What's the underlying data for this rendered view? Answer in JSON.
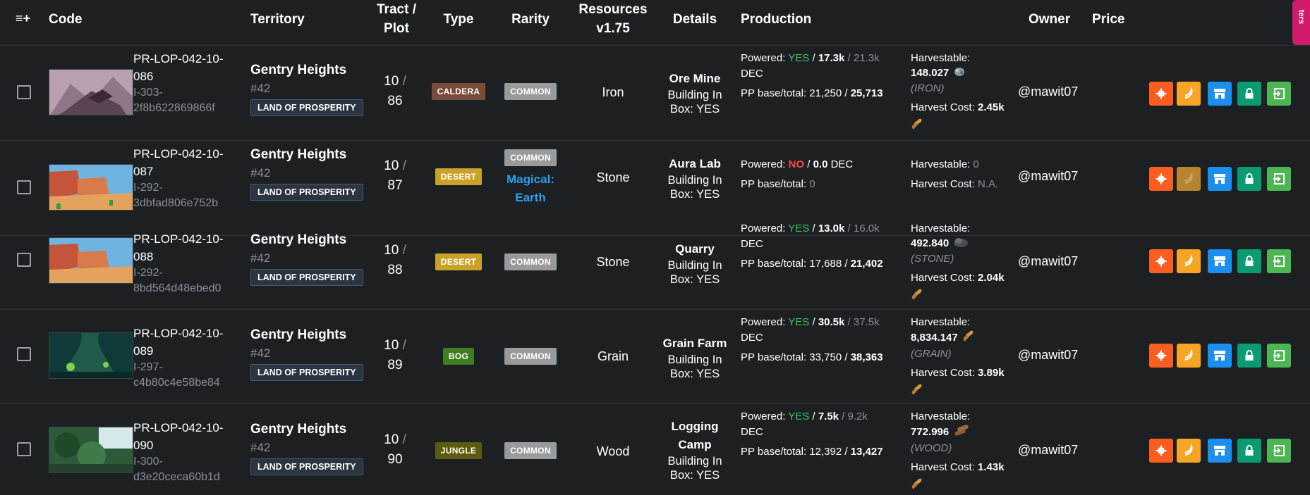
{
  "header": {
    "menu_icon": "≡+",
    "code": "Code",
    "territory": "Territory",
    "tract_plot": [
      "Tract /",
      "Plot"
    ],
    "type": "Type",
    "rarity": "Rarity",
    "resources": [
      "Resources",
      "v1.75"
    ],
    "details": "Details",
    "production": "Production",
    "owner": "Owner",
    "price": "Price",
    "filters_tab": "ters"
  },
  "colors": {
    "caldera": "#7a4b3a",
    "desert": "#c9a227",
    "bog": "#3f7d20",
    "jungle": "#5c5a0e",
    "common": "#9a9a9a",
    "gear": "#fd5d1e",
    "harvest": "#f8a424",
    "harvest_disabled": "#b8852e",
    "market": "#1b8ff0",
    "lock": "#0b9b73",
    "login": "#4bb652",
    "powered_yes": "#42c765",
    "powered_no": "#ff4747"
  },
  "rows": [
    {
      "code": [
        "PR-LOP-042-10-",
        "086"
      ],
      "id": [
        "I-303-",
        "2f8b622869866f"
      ],
      "territory": "Gentry Heights",
      "territory_num": "#42",
      "region": "LAND OF PROSPERITY",
      "tract": "10",
      "tract_sep": "/",
      "plot": "86",
      "type": "CALDERA",
      "rarity": "COMMON",
      "magical": "",
      "resource": "Iron",
      "detail_name": "Ore Mine",
      "detail_status": "Building In Box: YES",
      "powered_label": "Powered:",
      "powered": "YES",
      "pp_value": "17.3k",
      "pp_max": "21.3k",
      "pp_unit": "DEC",
      "pp_base_label": "PP base/total:",
      "pp_base": "21,250",
      "pp_total": "25,713",
      "harvestable_label": "Harvestable:",
      "harvestable": "148.027",
      "harvest_res": "(IRON)",
      "harvest_cost_label": "Harvest Cost:",
      "harvest_cost": "2.45k",
      "owner": "@mawit07"
    },
    {
      "code": [
        "PR-LOP-042-10-",
        "087"
      ],
      "id": [
        "I-292-",
        "3dbfad806e752b"
      ],
      "territory": "Gentry Heights",
      "territory_num": "#42",
      "region": "LAND OF PROSPERITY",
      "tract": "10",
      "tract_sep": "/",
      "plot": "87",
      "type": "DESERT",
      "rarity": "COMMON",
      "magical": [
        "Magical:",
        "Earth"
      ],
      "resource": "Stone",
      "detail_name": "Aura Lab",
      "detail_status": "Building In Box: YES",
      "powered_label": "Powered:",
      "powered": "NO",
      "pp_value": "0.0",
      "pp_unit": "DEC",
      "pp_base_label": "PP base/total:",
      "pp_base_plain": "0",
      "harvestable_label": "Harvestable:",
      "harvestable_plain": "0",
      "harvest_cost_label": "Harvest Cost:",
      "harvest_cost_plain": "N.A.",
      "owner": "@mawit07"
    },
    {
      "code": [
        "PR-LOP-042-10-",
        "088"
      ],
      "id": [
        "I-292-",
        "8bd564d48ebed0"
      ],
      "territory": "Gentry Heights",
      "territory_num": "#42",
      "region": "LAND OF PROSPERITY",
      "tract": "10",
      "tract_sep": "/",
      "plot": "88",
      "type": "DESERT",
      "rarity": "COMMON",
      "magical": "",
      "resource": "Stone",
      "detail_name": "Quarry",
      "detail_status": "Building In Box: YES",
      "powered_label": "Powered:",
      "powered": "YES",
      "pp_value": "13.0k",
      "pp_max": "16.0k",
      "pp_unit": "DEC",
      "pp_base_label": "PP base/total:",
      "pp_base": "17,688",
      "pp_total": "21,402",
      "harvestable_label": "Harvestable:",
      "harvestable": "492.840",
      "harvest_res": "(STONE)",
      "harvest_cost_label": "Harvest Cost:",
      "harvest_cost": "2.04k",
      "owner": "@mawit07"
    },
    {
      "code": [
        "PR-LOP-042-10-",
        "089"
      ],
      "id": [
        "I-297-",
        "c4b80c4e58be84"
      ],
      "territory": "Gentry Heights",
      "territory_num": "#42",
      "region": "LAND OF PROSPERITY",
      "tract": "10",
      "tract_sep": "/",
      "plot": "89",
      "type": "BOG",
      "rarity": "COMMON",
      "magical": "",
      "resource": "Grain",
      "detail_name": "Grain Farm",
      "detail_status": "Building In Box: YES",
      "powered_label": "Powered:",
      "powered": "YES",
      "pp_value": "30.5k",
      "pp_max": "37.5k",
      "pp_unit": "DEC",
      "pp_base_label": "PP base/total:",
      "pp_base": "33,750",
      "pp_total": "38,363",
      "harvestable_label": "Harvestable:",
      "harvestable": "8,834.147",
      "harvest_res": "(GRAIN)",
      "harvest_cost_label": "Harvest Cost:",
      "harvest_cost": "3.89k",
      "owner": "@mawit07"
    },
    {
      "code": [
        "PR-LOP-042-10-",
        "090"
      ],
      "id": [
        "I-300-",
        "d3e20ceca60b1d"
      ],
      "territory": "Gentry Heights",
      "territory_num": "#42",
      "region": "LAND OF PROSPERITY",
      "tract": "10",
      "tract_sep": "/",
      "plot": "90",
      "type": "JUNGLE",
      "rarity": "COMMON",
      "magical": "",
      "resource": "Wood",
      "detail_name": "Logging Camp",
      "detail_status": "Building In Box: YES",
      "powered_label": "Powered:",
      "powered": "YES",
      "pp_value": "7.5k",
      "pp_max": "9.2k",
      "pp_unit": "DEC",
      "pp_base_label": "PP base/total:",
      "pp_base": "12,392",
      "pp_total": "13,427",
      "harvestable_label": "Harvestable:",
      "harvestable": "772.996",
      "harvest_res": "(WOOD)",
      "harvest_cost_label": "Harvest Cost:",
      "harvest_cost": "1.43k",
      "owner": "@mawit07"
    }
  ]
}
